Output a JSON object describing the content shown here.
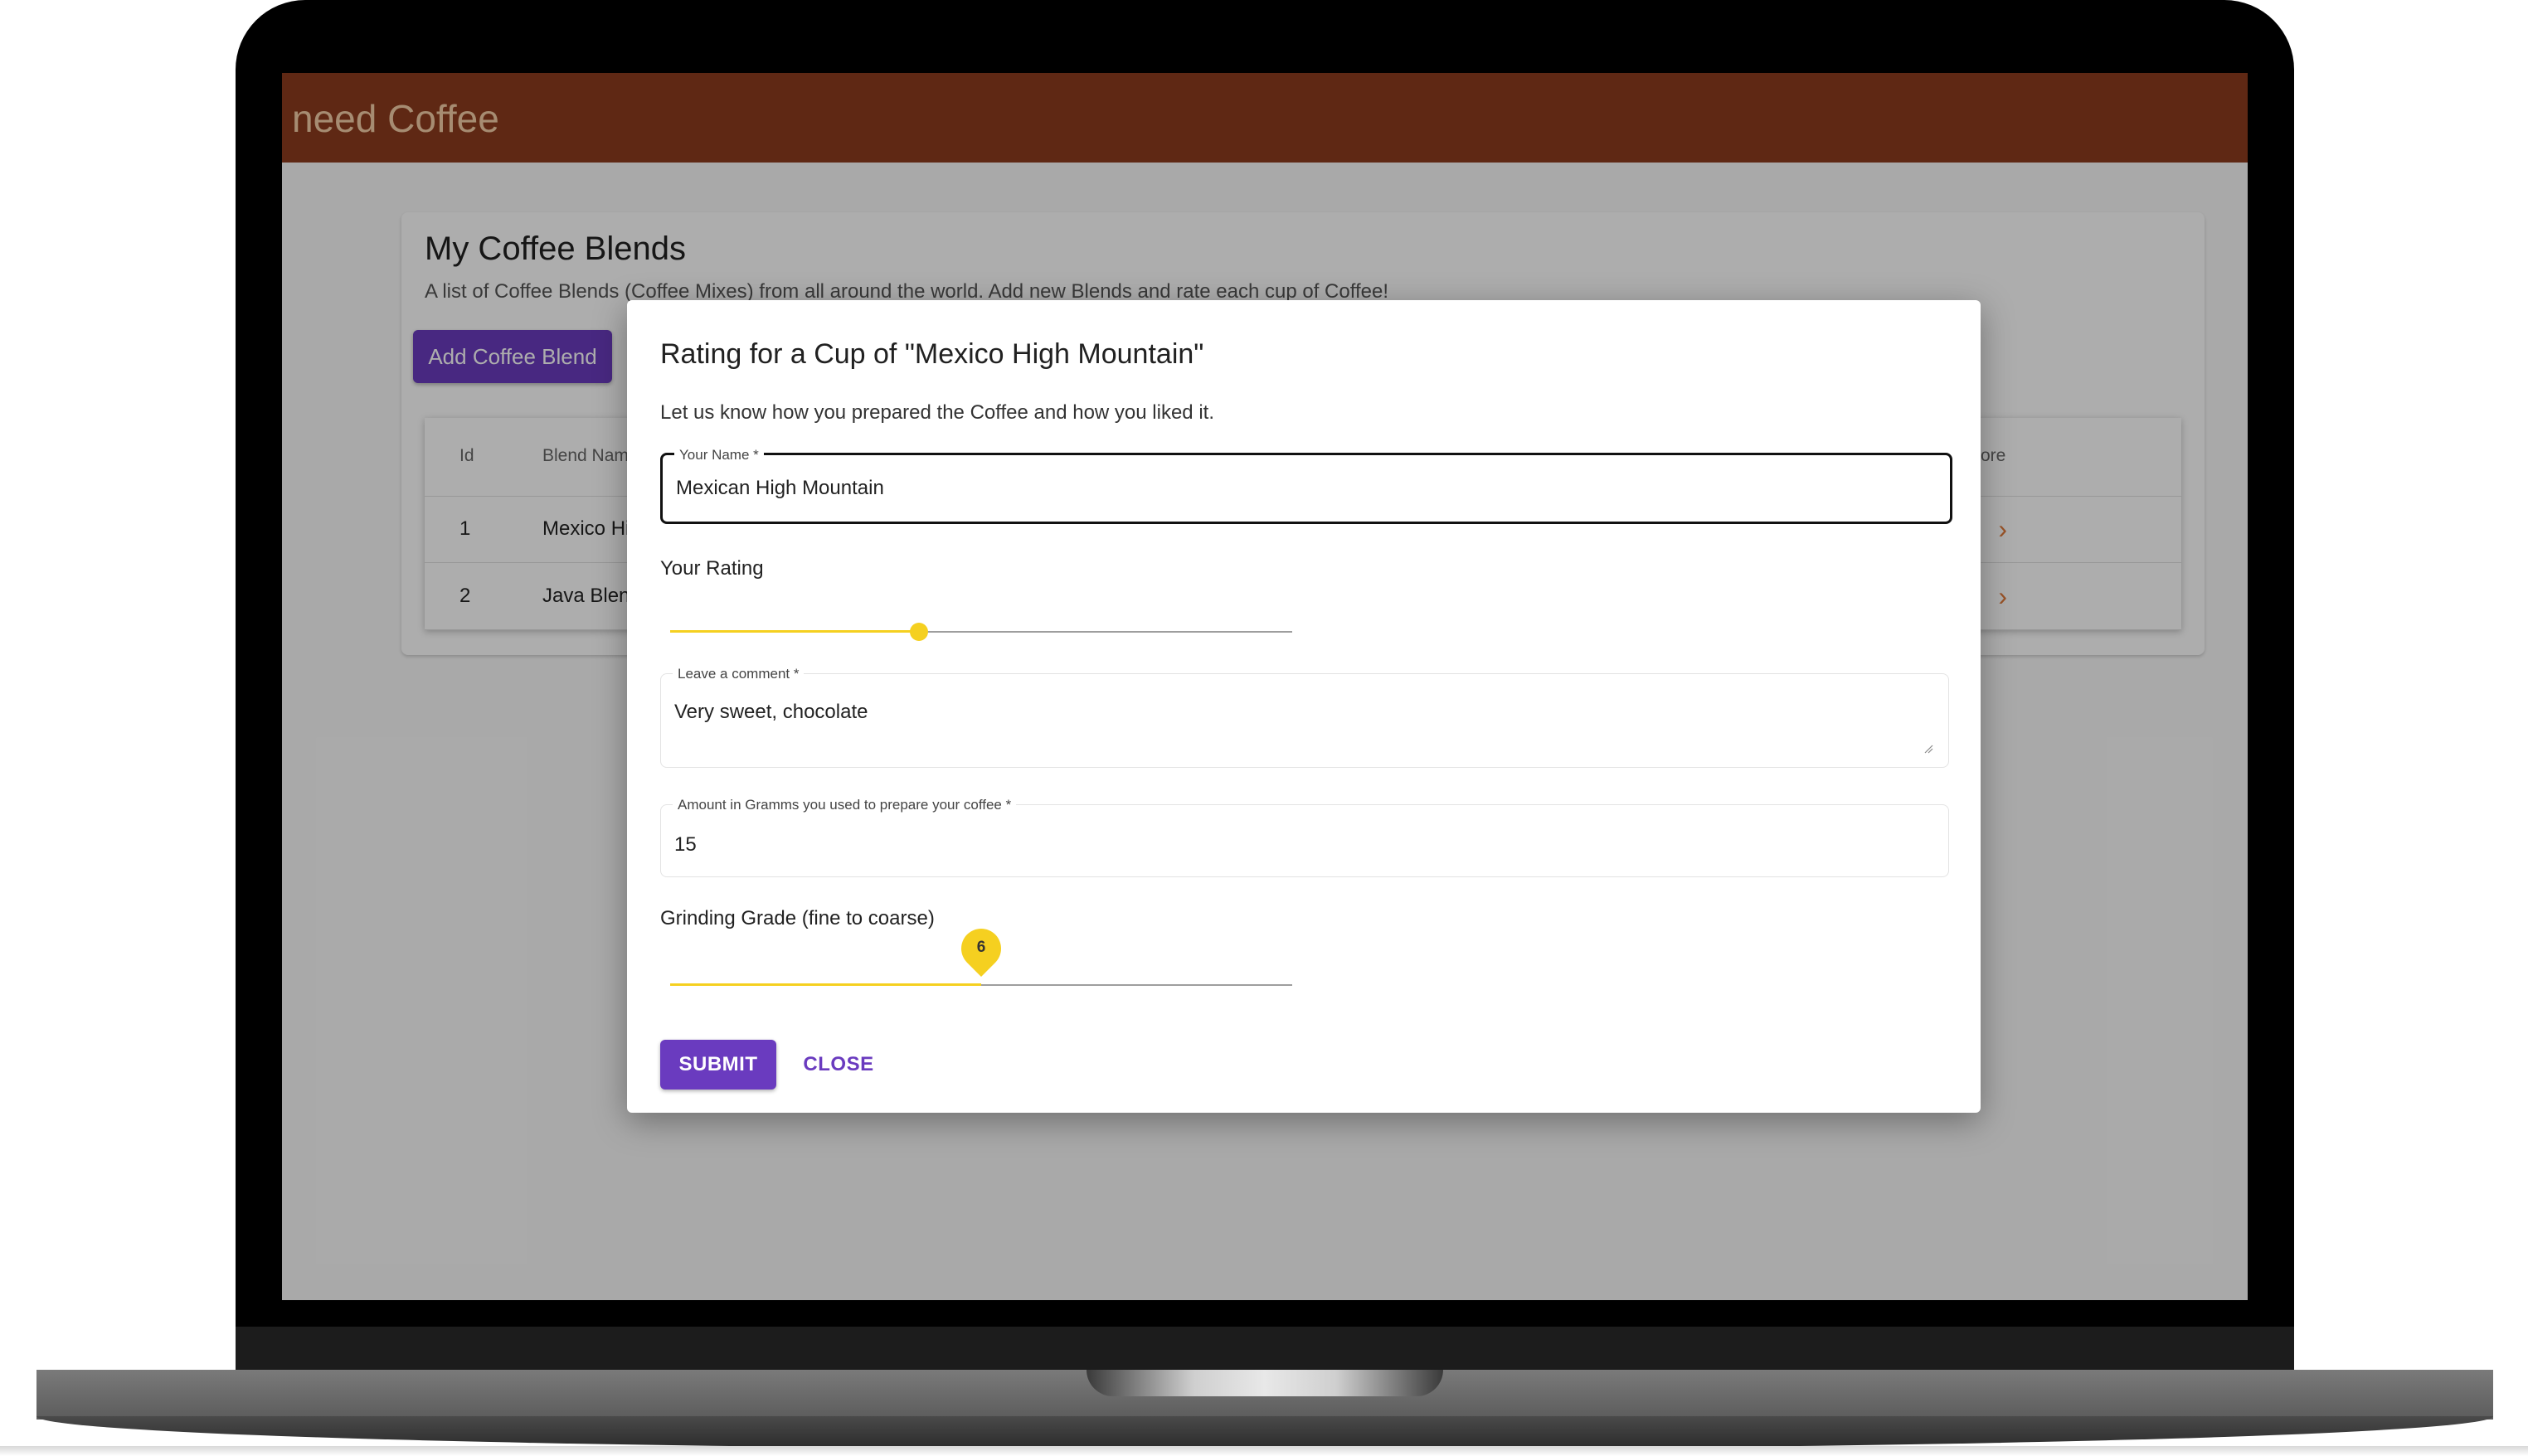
{
  "app": {
    "title": "need Coffee"
  },
  "page": {
    "title": "My Coffee Blends",
    "subtitle": "A list of Coffee Blends (Coffee Mixes) from all around the world. Add new Blends and rate each cup of Coffee!",
    "add_button": "Add Coffee Blend"
  },
  "table": {
    "columns": [
      "Id",
      "Blend Name",
      "ore"
    ],
    "rows": [
      {
        "id": "1",
        "name": "Mexico Hi"
      },
      {
        "id": "2",
        "name": "Java Blen"
      }
    ]
  },
  "dialog": {
    "title": "Rating for a Cup of \"Mexico High Mountain\"",
    "description": "Let us know how you prepared the Coffee and how you liked it.",
    "name_field": {
      "label": "Your Name *",
      "value": "Mexican High Mountain"
    },
    "rating": {
      "label": "Your Rating",
      "value_fraction": 0.4
    },
    "comment_field": {
      "label": "Leave a comment *",
      "value": "Very sweet, chocolate"
    },
    "amount_field": {
      "label": "Amount in Gramms you used to prepare your coffee *",
      "value": "15"
    },
    "grinding": {
      "label": "Grinding Grade (fine to coarse)",
      "value": "6",
      "value_fraction": 0.5
    },
    "submit_label": "SUBMIT",
    "close_label": "CLOSE"
  },
  "colors": {
    "appbar": "#8d3b1e",
    "primary": "#6a3bbf",
    "slider": "#f5d020"
  }
}
